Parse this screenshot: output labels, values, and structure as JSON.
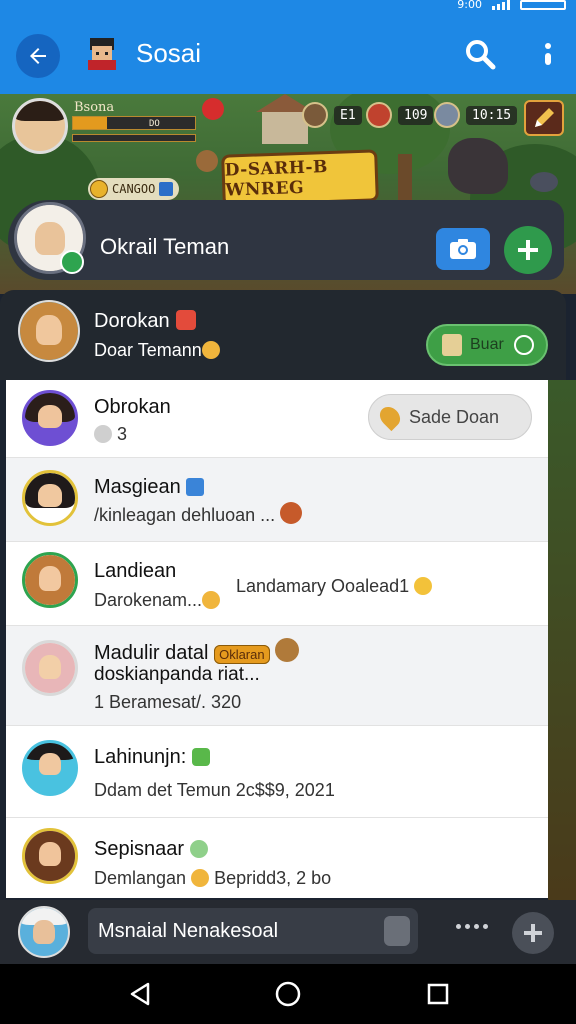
{
  "status_bar": {
    "left_text": "",
    "right_text": "9:00"
  },
  "appbar": {
    "title": "Sosai"
  },
  "game": {
    "player_name": "Bsona",
    "hp_label": "DO",
    "hp_level": 0.28,
    "coin_label": "CANGOO",
    "resources": [
      "E1",
      "109",
      "10:15"
    ],
    "logo_text": "D-SARH-B WNREG"
  },
  "friend_search": {
    "title": "Okrail Teman"
  },
  "active_chat": {
    "name": "Dorokan",
    "subtitle": "Doar Temann",
    "button_label": "Buar"
  },
  "chats": [
    {
      "name": "Obrokan",
      "message": "3",
      "aside": "Sade Doan"
    },
    {
      "name": "Masgiean",
      "message": "/kinleagan dehluoan ..."
    },
    {
      "name": "Landiean",
      "message": "Darokenam...",
      "aside": "Landamary Ooalead1"
    },
    {
      "name": "Madulir datal",
      "badge": "Oklaran",
      "message": "doskianpanda riat...",
      "detail": "1 Beramesat/. 320"
    },
    {
      "name": "Lahinunjn:",
      "message": "Ddam det Temun 2c$$9, 2021"
    },
    {
      "name": "Sepisnaar",
      "message": "Demlangan",
      "aside": "Bepridd3, 2 bo"
    }
  ],
  "composer": {
    "text": "Msnaial Nenakesoal"
  },
  "colors": {
    "primary": "#1e88e5",
    "accent_green": "#2f9a4c",
    "dark_bg": "#22282f"
  }
}
